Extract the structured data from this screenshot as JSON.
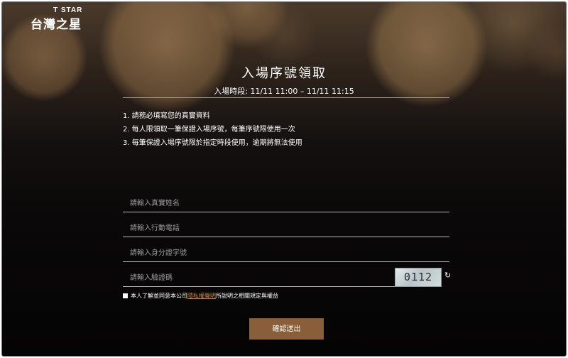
{
  "brand": {
    "en": "T STAR",
    "zh": "台灣之星"
  },
  "page": {
    "title": "入場序號領取",
    "subtitle": "入場時段: 11/11 11:00 – 11/11 11:15"
  },
  "notes": [
    "1. 請務必填寫您的真實資料",
    "2. 每人限領取一筆保證入場序號，每筆序號限使用一次",
    "3. 每筆保證入場序號限於指定時段使用，逾期將無法使用"
  ],
  "form": {
    "name_placeholder": "請輸入真實姓名",
    "phone_placeholder": "請輸入行動電話",
    "id_placeholder": "請輸入身分證字號",
    "captcha_placeholder": "請輸入驗證碼",
    "captcha_code": "0112",
    "refresh_icon": "refresh-icon",
    "agree_prefix": "本人了解並同意本公司",
    "agree_link": "隱私權聲明",
    "agree_suffix": "所說明之相關規定與權益",
    "agree_checked": false,
    "submit_label": "確認送出"
  },
  "colors": {
    "accent": "#8a5e38",
    "link": "#c0894d"
  }
}
